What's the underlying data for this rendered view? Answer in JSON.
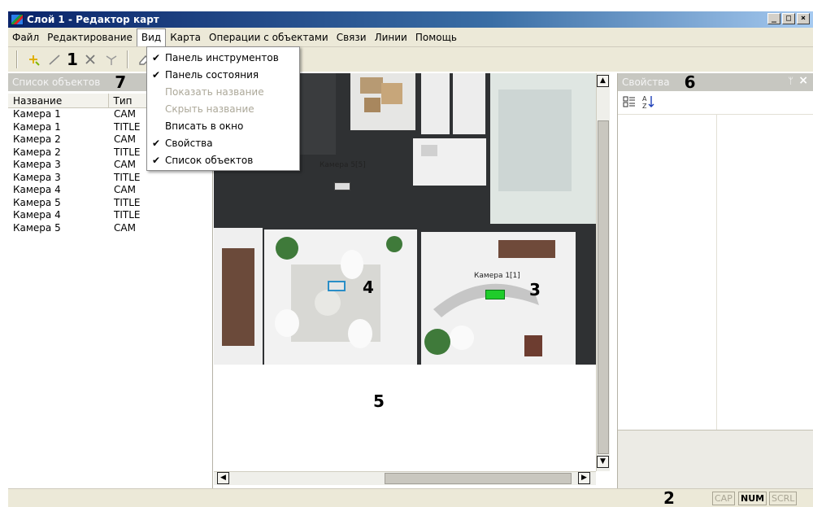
{
  "window": {
    "title": "Слой 1 - Редактор карт",
    "buttons": [
      "_",
      "□",
      "×"
    ]
  },
  "menubar": {
    "items": [
      "Файл",
      "Редактирование",
      "Вид",
      "Карта",
      "Операции с объектами",
      "Связи",
      "Линии",
      "Помощь"
    ],
    "open_item": "Вид"
  },
  "view_menu": {
    "items": [
      {
        "label": "Панель инструментов",
        "checked": true,
        "enabled": true
      },
      {
        "label": "Панель состояния",
        "checked": true,
        "enabled": true
      },
      {
        "label": "Показать название",
        "checked": false,
        "enabled": false
      },
      {
        "label": "Скрыть название",
        "checked": false,
        "enabled": false
      },
      {
        "label": "Вписать в окно",
        "checked": false,
        "enabled": true
      },
      {
        "label": "Свойства",
        "checked": true,
        "enabled": true
      },
      {
        "label": "Список объектов",
        "checked": true,
        "enabled": true
      }
    ]
  },
  "toolbar": {
    "callout": "1",
    "icons": [
      "add-point-icon",
      "draw-line-icon",
      "delete-icon",
      "move-points-icon",
      "eraser-icon"
    ]
  },
  "object_list": {
    "title": "Список объектов",
    "callout": "7",
    "columns": [
      "Название",
      "Тип"
    ],
    "rows": [
      [
        "Камера 1",
        "CAM"
      ],
      [
        "Камера 1",
        "TITLE"
      ],
      [
        "Камера 2",
        "CAM"
      ],
      [
        "Камера 2",
        "TITLE"
      ],
      [
        "Камера 3",
        "CAM"
      ],
      [
        "Камера 3",
        "TITLE"
      ],
      [
        "Камера 4",
        "CAM"
      ],
      [
        "Камера 5",
        "TITLE"
      ],
      [
        "Камера 4",
        "TITLE"
      ],
      [
        "Камера 5",
        "CAM"
      ]
    ]
  },
  "map": {
    "camera_labels": [
      "Камера 5[5]",
      "Камера 1[1]"
    ],
    "callouts": [
      "3",
      "4",
      "5"
    ]
  },
  "properties": {
    "title": "Свойства",
    "callout": "6",
    "pin": "ᛘ",
    "close": "×"
  },
  "statusbar": {
    "callout": "2",
    "indicators": [
      {
        "label": "CAP",
        "active": false
      },
      {
        "label": "NUM",
        "active": true
      },
      {
        "label": "SCRL",
        "active": false
      }
    ]
  },
  "colors": {
    "titlebar": "#0a246a",
    "panel_header": "#c7c7c1",
    "camera_active": "#1fcc2b"
  }
}
